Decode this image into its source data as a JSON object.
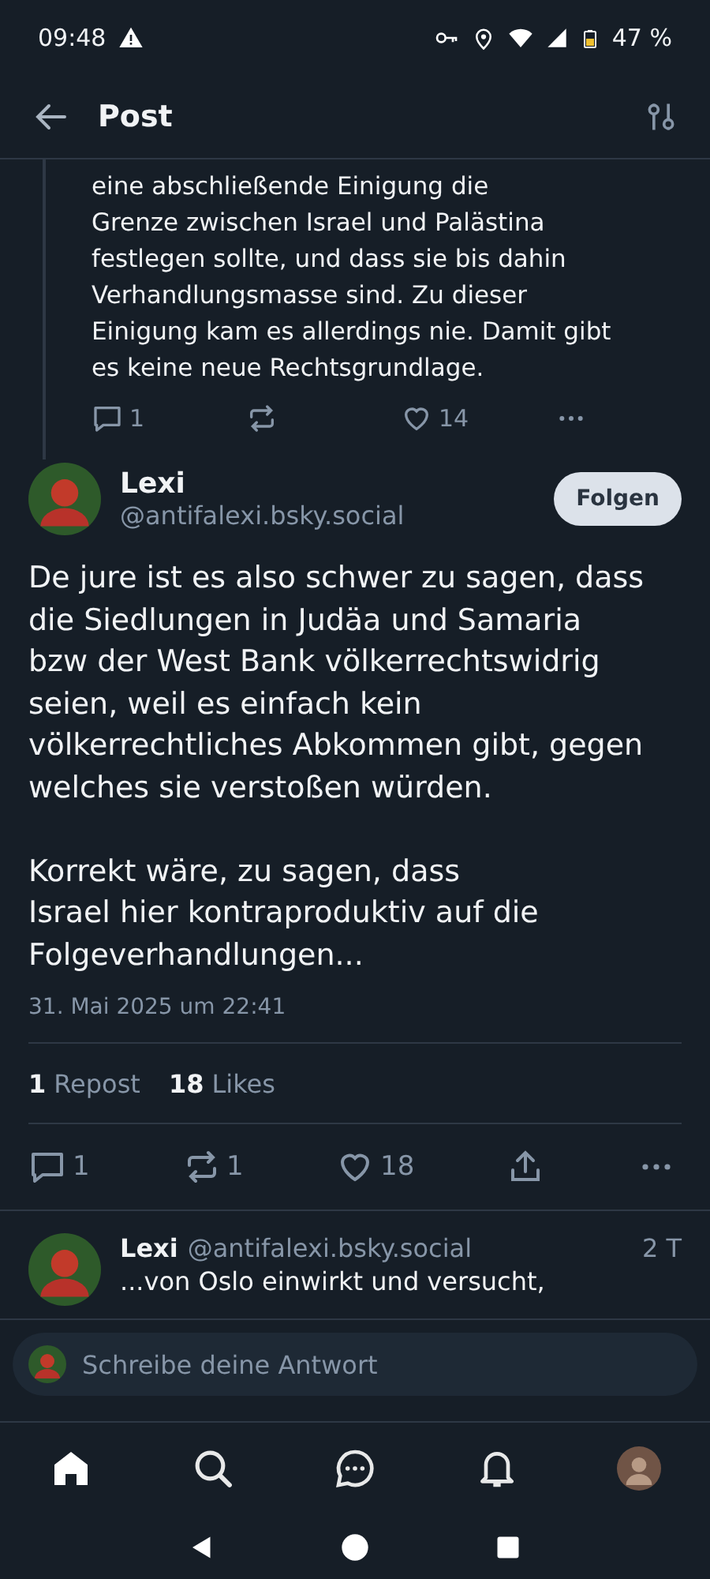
{
  "status_bar": {
    "time": "09:48",
    "battery": "47 %"
  },
  "header": {
    "title": "Post"
  },
  "parent_post": {
    "text": "eine abschließende Einigung die\nGrenze zwischen Israel und Palästina\nfestlegen sollte, und dass sie bis dahin\nVerhandlungsmasse sind. Zu dieser\nEinigung kam es allerdings nie. Damit gibt\nes keine neue Rechtsgrundlage.",
    "replies": "1",
    "likes": "14"
  },
  "post": {
    "author": "Lexi",
    "handle": "@antifalexi.bsky.social",
    "follow_button": "Folgen",
    "text": "De jure ist es also schwer zu sagen, dass\ndie Siedlungen in Judäa und Samaria\nbzw der West Bank völkerrechtswidrig\nseien, weil es einfach kein\nvölkerrechtliches Abkommen gibt, gegen\nwelches sie verstoßen würden.\n\nKorrekt wäre, zu sagen, dass\nIsrael hier kontraproduktiv auf die\nFolgeverhandlungen...",
    "date": "31. Mai 2025 um 22:41",
    "stats": [
      {
        "count": "1",
        "label": "Repost"
      },
      {
        "count": "18",
        "label": "Likes"
      }
    ],
    "replies": "1",
    "reposts": "1",
    "likes": "18"
  },
  "reply": {
    "author": "Lexi",
    "handle": "@antifalexi.bsky.social",
    "age": "2 T",
    "text": "...von Oslo einwirkt und versucht,"
  },
  "composer": {
    "placeholder": "Schreibe deine Antwort"
  },
  "tab_bar": [
    {
      "kind": "home",
      "selected": true
    },
    {
      "kind": "search",
      "selected": false
    },
    {
      "kind": "chat",
      "selected": false
    },
    {
      "kind": "bell",
      "selected": false
    },
    {
      "kind": "avatar",
      "selected": false
    }
  ]
}
